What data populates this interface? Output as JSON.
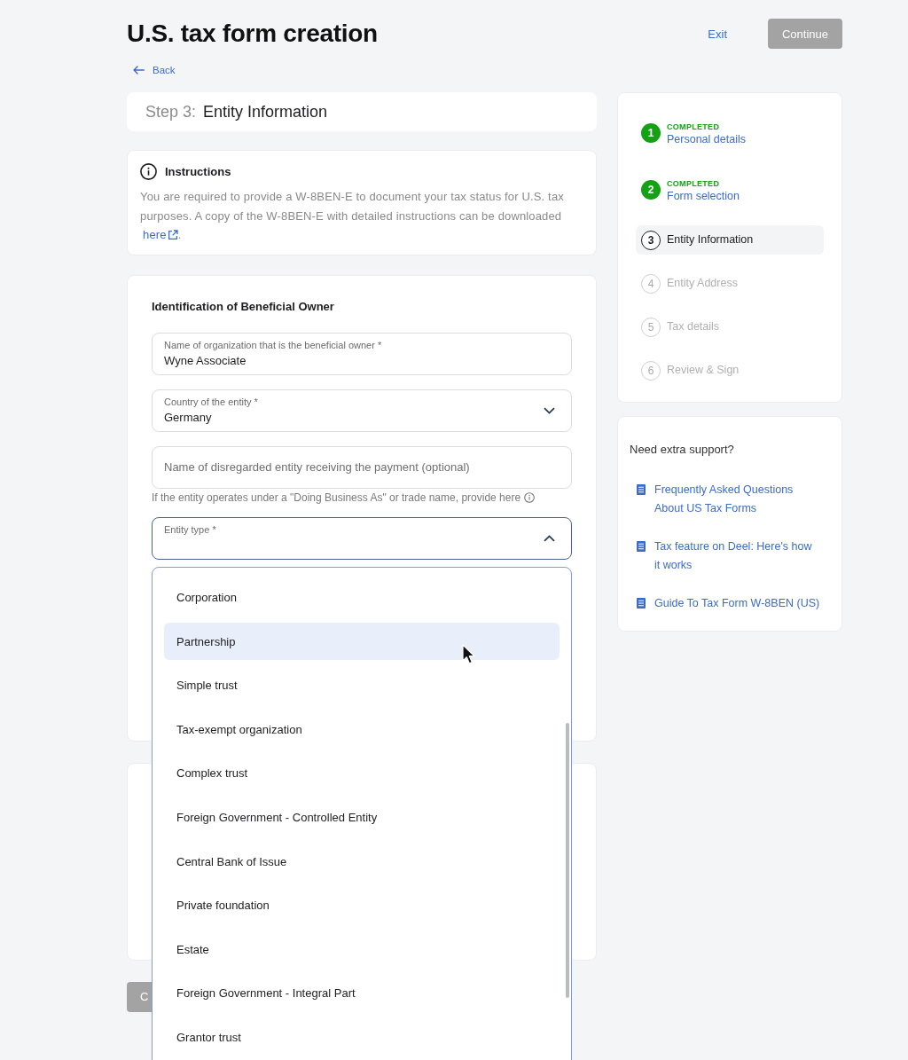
{
  "header": {
    "title": "U.S. tax form creation",
    "exit_link": "Exit",
    "continue_button": {
      "label": "Continue",
      "disabled": true
    },
    "back_link": "Back"
  },
  "step": {
    "prefix": "Step 3:",
    "title": "Entity Information"
  },
  "instructions": {
    "title": "Instructions",
    "text": "You are required to provide a W-8BEN-E to document your tax status for U.S. tax purposes. A copy of the W-8BEN-E with detailed instructions can be downloaded",
    "link": "here",
    "end": "."
  },
  "form": {
    "title": "Identification of Beneficial Owner",
    "fields": [
      {
        "kind": "text",
        "label": "Name of organization that is the beneficial owner *",
        "value": "Wyne Associate"
      },
      {
        "kind": "select",
        "label": "Country of the entity *",
        "value": "Germany",
        "expanded": false
      },
      {
        "kind": "text",
        "placeholder": "Name of disregarded entity receiving the payment (optional)",
        "helper": "If the entity operates under a \"Doing Business As\" or trade name, provide here"
      },
      {
        "kind": "select",
        "label": "Entity type *",
        "expanded": true,
        "options": [
          {
            "label": "Corporation",
            "highlighted": false
          },
          {
            "label": "Partnership",
            "highlighted": true
          },
          {
            "label": "Simple trust",
            "highlighted": false
          },
          {
            "label": "Tax-exempt organization",
            "highlighted": false
          },
          {
            "label": "Complex trust",
            "highlighted": false
          },
          {
            "label": "Foreign Government - Controlled Entity",
            "highlighted": false
          },
          {
            "label": "Central Bank of Issue",
            "highlighted": false
          },
          {
            "label": "Private foundation",
            "highlighted": false
          },
          {
            "label": "Estate",
            "highlighted": false
          },
          {
            "label": "Foreign Government - Integral Part",
            "highlighted": false
          },
          {
            "label": "Grantor trust",
            "highlighted": false
          }
        ]
      }
    ]
  },
  "footer_button": {
    "label": "C",
    "disabled": true
  },
  "progress": {
    "steps": [
      {
        "number": "1",
        "status": "COMPLETED",
        "label": "Personal details",
        "completed": true,
        "selected": false,
        "disabled": false
      },
      {
        "number": "2",
        "status": "COMPLETED",
        "label": "Form selection",
        "completed": true,
        "selected": false,
        "disabled": false
      },
      {
        "number": "3",
        "label": "Entity Information",
        "completed": false,
        "selected": true,
        "disabled": false
      },
      {
        "number": "4",
        "label": "Entity Address",
        "completed": false,
        "selected": false,
        "disabled": true
      },
      {
        "number": "5",
        "label": "Tax details",
        "completed": false,
        "selected": false,
        "disabled": true
      },
      {
        "number": "6",
        "label": "Review & Sign",
        "completed": false,
        "selected": false,
        "disabled": true
      }
    ]
  },
  "support": {
    "title": "Need extra support?",
    "links": [
      "Frequently Asked Questions About US Tax Forms",
      "Tax feature on Deel: Here's how it works",
      "Guide To Tax Form W-8BEN (US)"
    ]
  }
}
